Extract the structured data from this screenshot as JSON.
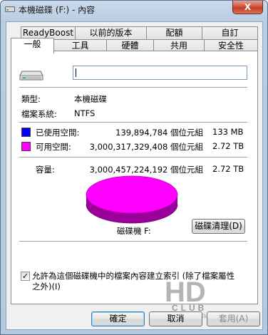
{
  "window": {
    "title": "本機磁碟 (F:) - 內容",
    "close_glyph": "X"
  },
  "tabs": {
    "row1": [
      {
        "label": "ReadyBoost"
      },
      {
        "label": "以前的版本"
      },
      {
        "label": "配額"
      },
      {
        "label": "自訂"
      }
    ],
    "row2": [
      {
        "label": "一般",
        "active": true
      },
      {
        "label": "工具"
      },
      {
        "label": "硬體"
      },
      {
        "label": "共用"
      },
      {
        "label": "安全性"
      }
    ]
  },
  "general": {
    "drive_icon": "hard-drive-icon",
    "name_value": "",
    "type_label": "類型:",
    "type_value": "本機磁碟",
    "fs_label": "檔案系統:",
    "fs_value": "NTFS",
    "used_label": "已使用空間:",
    "used_bytes": "139,894,784 個位元組",
    "used_size": "133 MB",
    "used_color": "#0000ff",
    "free_label": "可用空間:",
    "free_bytes": "3,000,317,329,408 個位元組",
    "free_size": "2.72 TB",
    "free_color": "#ff00ff",
    "capacity_label": "容量:",
    "capacity_bytes": "3,000,457,224,192 個位元組",
    "capacity_size": "2.72 TB",
    "drive_caption": "磁碟機 F:",
    "cleanup_button": "磁碟清理(D)",
    "index_checkbox_checked": true,
    "index_checkbox_line1": "允許為這個磁碟機中的檔案內容建立索引 (除了檔案屬性",
    "index_checkbox_line2": "之外)(I)"
  },
  "buttons": {
    "ok": "確定",
    "cancel": "取消",
    "apply": "套用(A)"
  },
  "watermark": {
    "logo_text": "HD",
    "sub_text": "CLUB",
    "url": "www.HD.Club.tw"
  }
}
